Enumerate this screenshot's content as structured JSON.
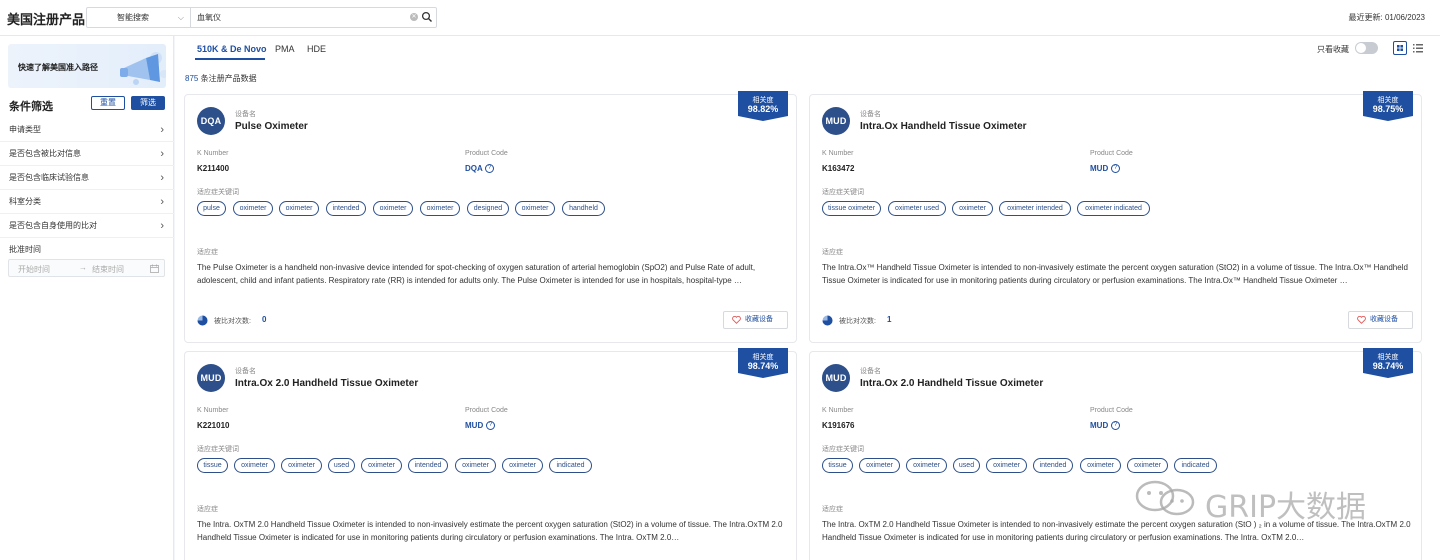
{
  "header": {
    "title": "美国注册产品",
    "search_type": "智能搜索",
    "search_value": "血氧仪",
    "last_update": "最近更新: 01/06/2023"
  },
  "sidebar": {
    "banner_text": "快速了解美国准入路径",
    "filter_title": "条件筛选",
    "reset_label": "重置",
    "filter_label": "筛选",
    "items": [
      {
        "label": "申请类型"
      },
      {
        "label": "是否包含被比对信息"
      },
      {
        "label": "是否包含临床试验信息"
      },
      {
        "label": "科室分类"
      },
      {
        "label": "是否包含自身使用的比对"
      }
    ],
    "date_label": "批准时间",
    "date_start_placeholder": "开始时间",
    "date_sep": "→",
    "date_end_placeholder": "结束时间"
  },
  "tabs": [
    {
      "label": "510K & De Novo",
      "active": true
    },
    {
      "label": "PMA",
      "active": false
    },
    {
      "label": "HDE",
      "active": false
    }
  ],
  "toolbar": {
    "fav_only_label": "只看收藏"
  },
  "result_count": {
    "number": "875",
    "suffix": " 条注册产品数据"
  },
  "labels": {
    "device_name": "设备名",
    "k_number": "K Number",
    "product_code": "Product Code",
    "keywords": "适应症关键词",
    "indication": "适应症",
    "relevance": "相关度",
    "compare_count": "被比对次数:",
    "favorite": "收藏设备"
  },
  "colors": {
    "primary": "#1f4fa0",
    "avatar": "#2d4f8a"
  },
  "cards": [
    {
      "avatar": "DQA",
      "name": "Pulse Oximeter",
      "relevance": "98.82%",
      "k_number": "K211400",
      "product_code": "DQA",
      "keywords": [
        "pulse",
        "oximeter",
        "oximeter",
        "intended",
        "oximeter",
        "oximeter",
        "designed",
        "oximeter",
        "handheld"
      ],
      "description": "The Pulse Oximeter is a handheld non-invasive device intended for spot-checking of oxygen saturation of arterial hemoglobin (SpO2) and Pulse Rate of adult, adolescent, child and infant patients. Respiratory rate (RR) is intended for adults only. The Pulse Oximeter is intended for use in hospitals, hospital-type …",
      "compare_count": "0"
    },
    {
      "avatar": "MUD",
      "name": "Intra.Ox Handheld Tissue Oximeter",
      "relevance": "98.75%",
      "k_number": "K163472",
      "product_code": "MUD",
      "keywords": [
        "tissue oximeter",
        "oximeter used",
        "oximeter",
        "oximeter intended",
        "oximeter indicated"
      ],
      "description": "The Intra.Ox™ Handheld Tissue Oximeter is intended to non-invasively estimate the percent oxygen saturation (StO2) in a volume of tissue. The Intra.Ox™ Handheld Tissue Oximeter is indicated for use in monitoring patients during circulatory or perfusion examinations. The Intra.Ox™ Handheld Tissue Oximeter …",
      "compare_count": "1"
    },
    {
      "avatar": "MUD",
      "name": "Intra.Ox 2.0 Handheld Tissue Oximeter",
      "relevance": "98.74%",
      "k_number": "K221010",
      "product_code": "MUD",
      "keywords": [
        "tissue",
        "oximeter",
        "oximeter",
        "used",
        "oximeter",
        "intended",
        "oximeter",
        "oximeter",
        "indicated"
      ],
      "description": "The Intra. OxTM 2.0 Handheld Tissue Oximeter is intended to non-invasively estimate the percent oxygen saturation (StO2) in a volume of tissue. The Intra.OxTM 2.0 Handheld Tissue Oximeter is indicated for use in monitoring patients during circulatory or perfusion examinations. The Intra. OxTM 2.0…"
    },
    {
      "avatar": "MUD",
      "name": "Intra.Ox 2.0 Handheld Tissue Oximeter",
      "relevance": "98.74%",
      "k_number": "K191676",
      "product_code": "MUD",
      "keywords": [
        "tissue",
        "oximeter",
        "oximeter",
        "used",
        "oximeter",
        "intended",
        "oximeter",
        "oximeter",
        "indicated"
      ],
      "description": "The Intra. OxTM 2.0 Handheld Tissue Oximeter is intended to non-invasively estimate the percent oxygen saturation (StO ) ₂ in a volume of tissue. The Intra.OxTM 2.0 Handheld Tissue Oximeter is indicated for use in monitoring patients during circulatory or perfusion examinations. The Intra. OxTM 2.0…"
    }
  ],
  "watermark": "GRIP大数据"
}
